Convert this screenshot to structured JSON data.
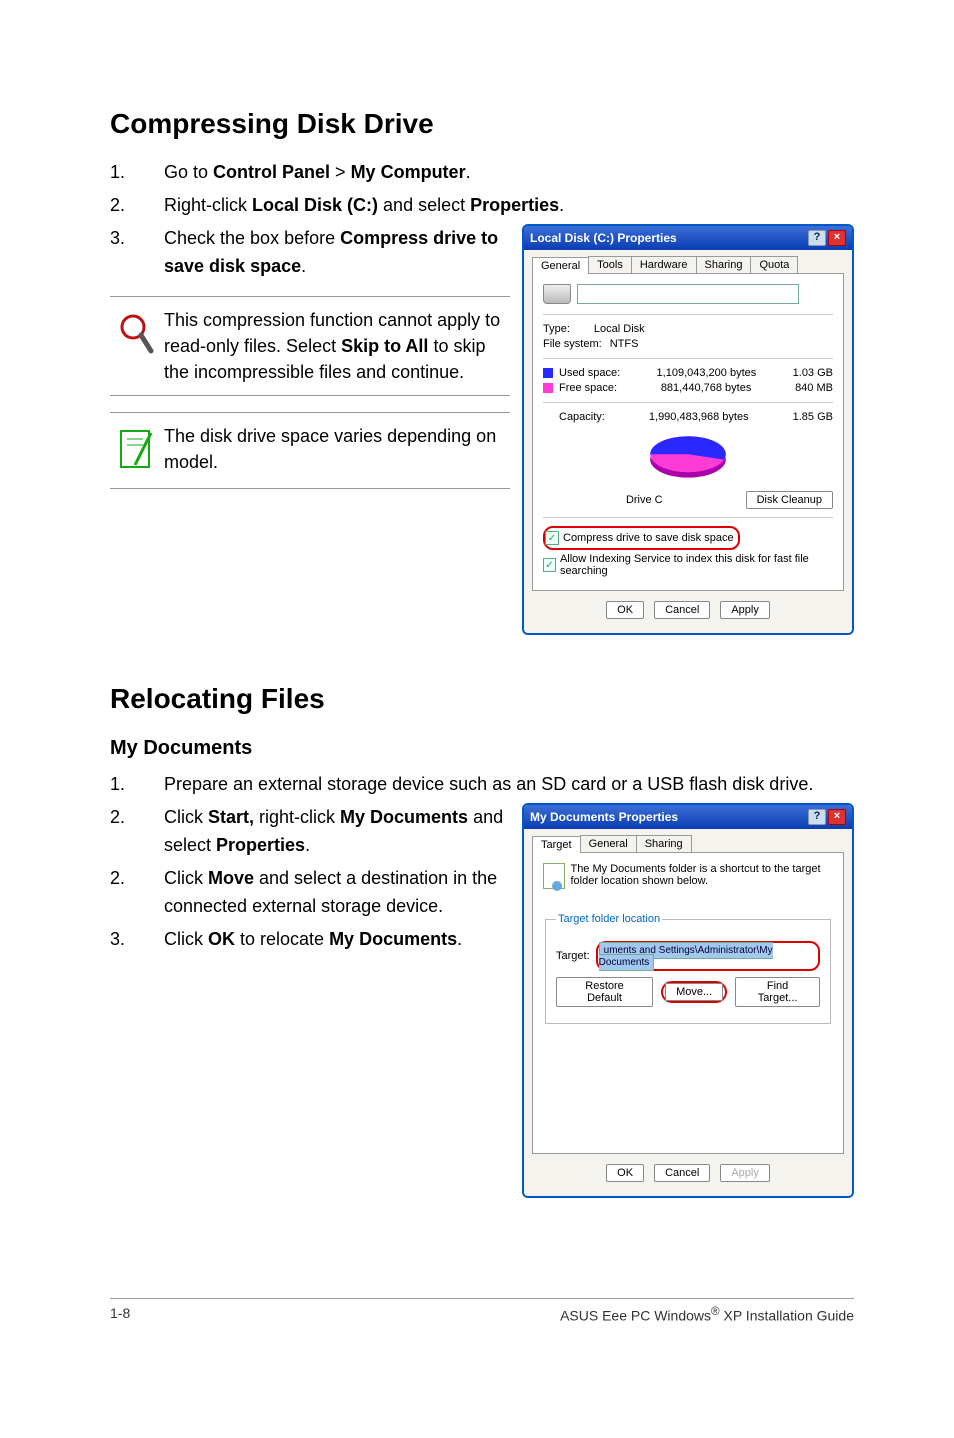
{
  "section1": {
    "heading": "Compressing Disk Drive",
    "steps": [
      {
        "num": "1.",
        "parts": [
          "Go to ",
          "Control Panel",
          " > ",
          "My Computer",
          "."
        ]
      },
      {
        "num": "2.",
        "parts": [
          "Right-click ",
          "Local Disk (C:)",
          " and select ",
          "Properties",
          "."
        ]
      },
      {
        "num": "3.",
        "parts": [
          "Check the box before ",
          "Compress drive to save disk space",
          "."
        ]
      }
    ],
    "note1": {
      "pre": "This compression function cannot apply to read-only files. Select ",
      "bold": "Skip to All ",
      "post": "to skip the incompressible files and continue."
    },
    "note2": "The disk drive space varies depending on model."
  },
  "dialog1": {
    "title": "Local Disk (C:) Properties",
    "tabs": [
      "General",
      "Tools",
      "Hardware",
      "Sharing",
      "Quota"
    ],
    "type_label": "Type:",
    "type_value": "Local Disk",
    "fs_label": "File system:",
    "fs_value": "NTFS",
    "used_label": "Used space:",
    "used_bytes": "1,109,043,200 bytes",
    "used_h": "1.03 GB",
    "free_label": "Free space:",
    "free_bytes": "881,440,768 bytes",
    "free_h": "840 MB",
    "cap_label": "Capacity:",
    "cap_bytes": "1,990,483,968 bytes",
    "cap_h": "1.85 GB",
    "drive_label": "Drive C",
    "cleanup": "Disk Cleanup",
    "cb1": "Compress drive to save disk space",
    "cb2": "Allow Indexing Service to index this disk for fast file searching",
    "ok": "OK",
    "cancel": "Cancel",
    "apply": "Apply"
  },
  "section2": {
    "heading": "Relocating Files",
    "sub": "My Documents",
    "steps": [
      {
        "num": "1.",
        "text": "Prepare an external storage device such as an SD card or a USB flash disk drive."
      },
      {
        "num": "2.",
        "parts": [
          "Click ",
          "Start, ",
          "right-click ",
          "My Documents ",
          "and select ",
          "Properties",
          "."
        ]
      },
      {
        "num": "2.",
        "parts": [
          "Click ",
          "Move",
          " and select a destination in the connected external storage device."
        ]
      },
      {
        "num": "3.",
        "parts": [
          "Click ",
          "OK",
          " to relocate ",
          "My Documents",
          "."
        ]
      }
    ]
  },
  "dialog2": {
    "title": "My Documents Properties",
    "tabs": [
      "Target",
      "General",
      "Sharing"
    ],
    "intro": "The My Documents folder is a shortcut to the target folder location shown below.",
    "group": "Target folder location",
    "target_label": "Target:",
    "target_value": "uments and Settings\\Administrator\\My Documents",
    "restore": "Restore Default",
    "move": "Move...",
    "find": "Find Target...",
    "ok": "OK",
    "cancel": "Cancel",
    "apply": "Apply"
  },
  "footer": {
    "left": "1-8",
    "right_pre": "ASUS Eee PC Windows",
    "right_reg": "®",
    "right_post": " XP Installation Guide"
  }
}
